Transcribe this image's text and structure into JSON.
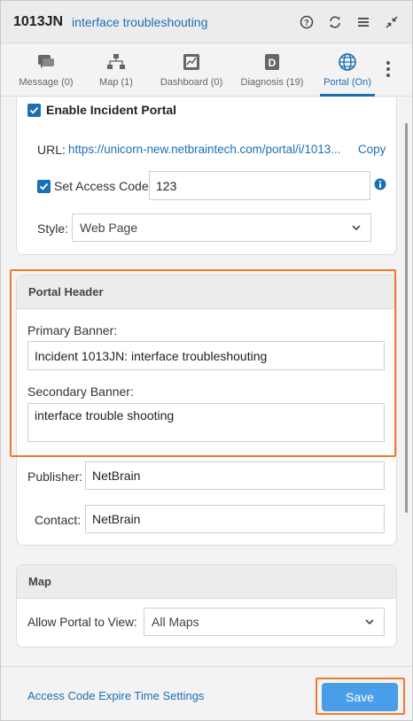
{
  "header": {
    "incident_id": "1013JN",
    "incident_name": "interface troubleshouting"
  },
  "tabs": [
    {
      "label": "Message (0)",
      "icon": "message-icon"
    },
    {
      "label": "Map (1)",
      "icon": "map-icon"
    },
    {
      "label": "Dashboard (0)",
      "icon": "dashboard-icon"
    },
    {
      "label": "Diagnosis (19)",
      "icon": "diagnosis-icon",
      "glyph": "D"
    },
    {
      "label": "Portal (On)",
      "icon": "globe-icon",
      "active": true
    }
  ],
  "portal": {
    "enable_label": "Enable Incident Portal",
    "enable_checked": true,
    "url_label": "URL:",
    "url_value": "https://unicorn-new.netbraintech.com/portal/i/1013...",
    "copy_label": "Copy",
    "access_code_label": "Set Access Code:",
    "access_code_checked": true,
    "access_code_value": "123",
    "style_label": "Style:",
    "style_value": "Web Page"
  },
  "portal_header": {
    "title": "Portal Header",
    "primary_label": "Primary Banner:",
    "primary_value": "Incident 1013JN: interface troubleshouting",
    "secondary_label": "Secondary Banner:",
    "secondary_value": "interface trouble shooting",
    "publisher_label": "Publisher:",
    "publisher_value": "NetBrain",
    "contact_label": "Contact:",
    "contact_value": "NetBrain"
  },
  "map_section": {
    "title": "Map",
    "allow_label": "Allow Portal to View:",
    "allow_value": "All Maps"
  },
  "footer": {
    "expire_link": "Access Code Expire Time Settings",
    "save_label": "Save"
  },
  "colors": {
    "accent": "#1b6fb5",
    "highlight": "#f07a2c",
    "save_button": "#4a9de8"
  }
}
